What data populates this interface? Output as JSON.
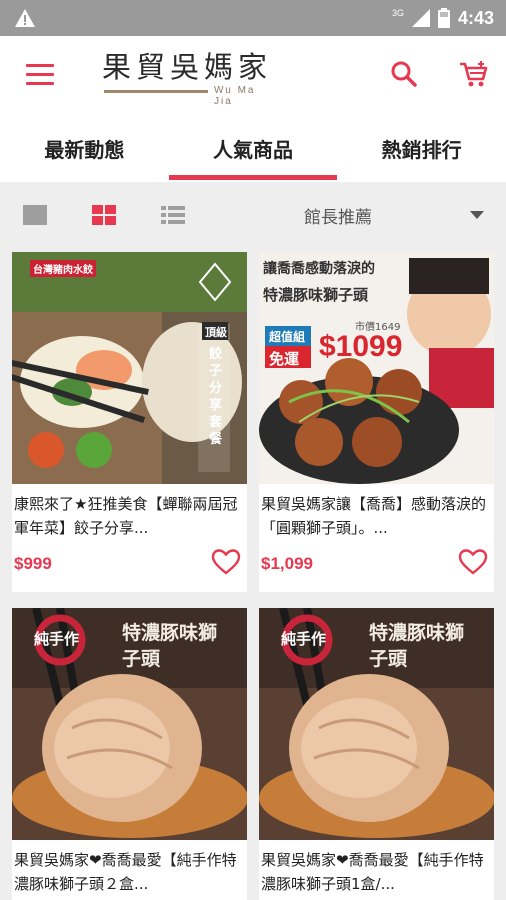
{
  "status_bar": {
    "time": "4:43",
    "network": "3G"
  },
  "app_bar": {
    "logo_text": "果貿吳媽家",
    "logo_sub": "Wu Ma Jia",
    "menu_icon": "menu-icon",
    "search_icon": "search-icon",
    "cart_icon": "cart-icon",
    "accent_color": "#e8384f"
  },
  "tabs": [
    {
      "label": "最新動態",
      "active": false
    },
    {
      "label": "人氣商品",
      "active": true
    },
    {
      "label": "熱銷排行",
      "active": false
    }
  ],
  "toolbar": {
    "view_modes": [
      "single-view-icon",
      "grid-view-icon",
      "list-view-icon"
    ],
    "active_view": "grid-view-icon",
    "sort_selected": "館長推薦"
  },
  "products": [
    {
      "title": "康熙來了★狂推美食【蟬聯兩屆冠軍年菜】餃子分享...",
      "price": "$999",
      "photo_text": {
        "vertical": "餃子分享套餐",
        "badge": "頂級",
        "top": "台灣豬肉水餃"
      }
    },
    {
      "title": "果貿吳媽家讓【喬喬】感動落淚的「圓顆獅子頭」。...",
      "price": "$1,099",
      "photo_text": {
        "headline1": "讓喬喬感動落淚的",
        "headline2": "特濃豚味獅子頭",
        "tag1": "超值組",
        "tag2": "免運",
        "strike": "市價1649",
        "sale": "$1099"
      }
    },
    {
      "title": "果貿吳媽家❤喬喬最愛【純手作特濃豚味獅子頭２盒...",
      "price": "",
      "photo_text": {
        "stamp": "純手作",
        "headline": "特濃豚味獅子頭"
      }
    },
    {
      "title": "果貿吳媽家❤喬喬最愛【純手作特濃豚味獅子頭1盒/...",
      "price": "",
      "photo_text": {
        "stamp": "純手作",
        "headline": "特濃豚味獅子頭"
      }
    }
  ]
}
